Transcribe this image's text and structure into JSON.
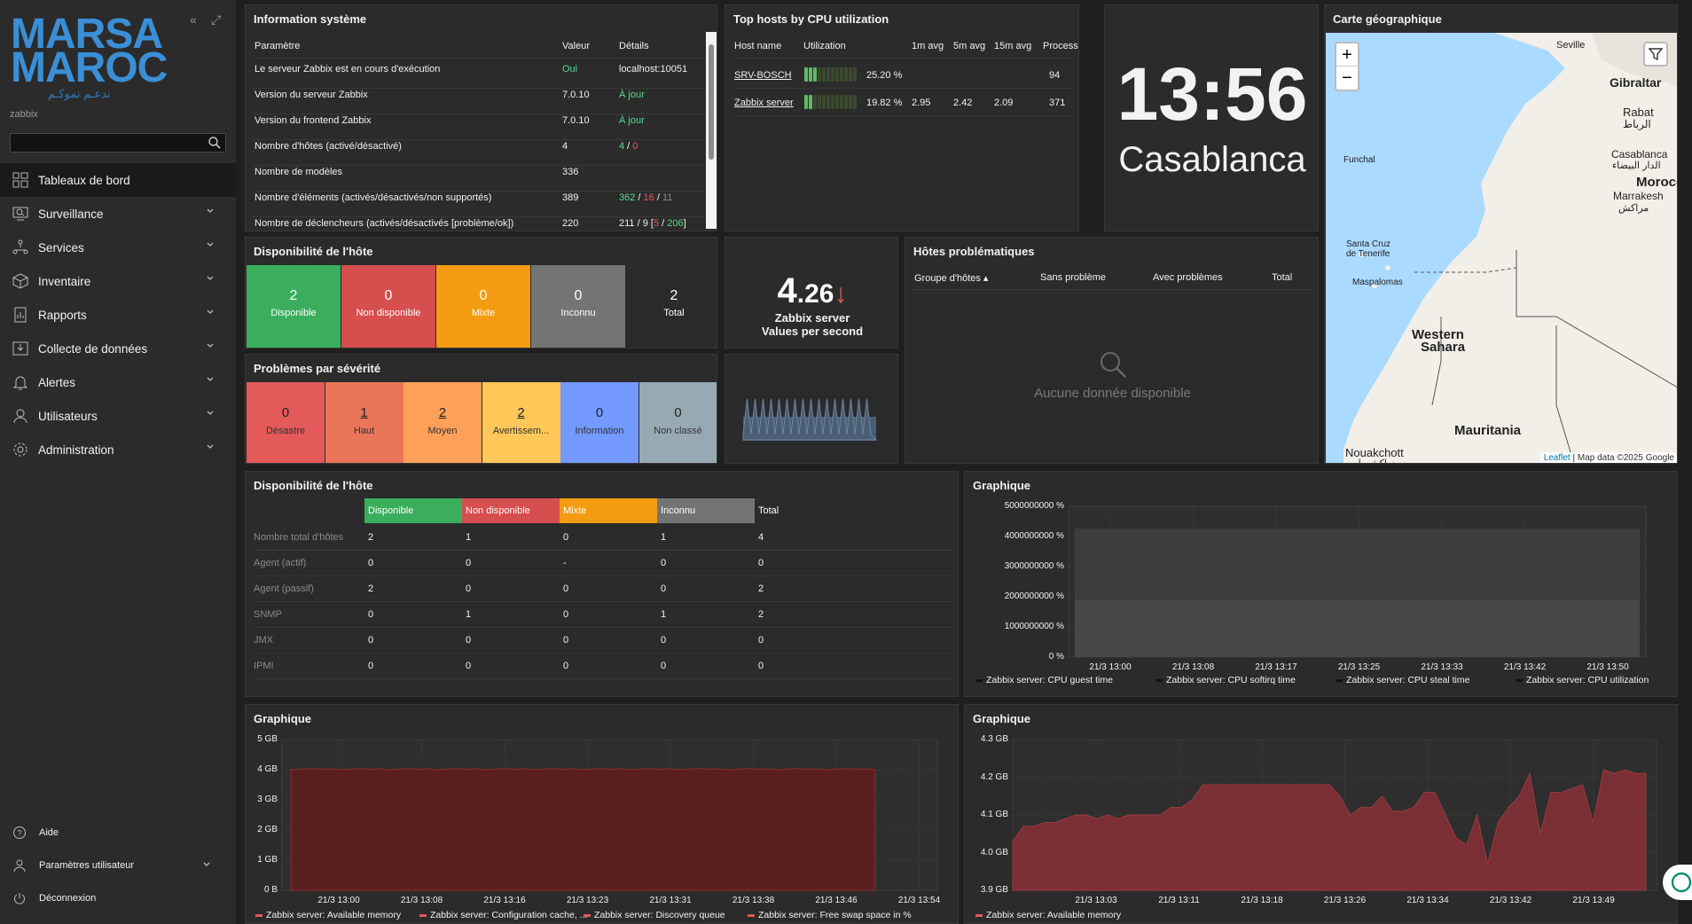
{
  "sidebar": {
    "brand": "zabbix",
    "logo": {
      "line1": "MARSA",
      "line2": "MAROC",
      "tagline": "ندعـم نموكـم"
    },
    "menu": [
      {
        "label": "Tableaux de bord",
        "icon": "dashboard-icon"
      },
      {
        "label": "Surveillance",
        "icon": "monitoring-icon"
      },
      {
        "label": "Services",
        "icon": "services-icon"
      },
      {
        "label": "Inventaire",
        "icon": "inventory-icon"
      },
      {
        "label": "Rapports",
        "icon": "reports-icon"
      },
      {
        "label": "Collecte de données",
        "icon": "data-collection-icon"
      },
      {
        "label": "Alertes",
        "icon": "bell-icon"
      },
      {
        "label": "Utilisateurs",
        "icon": "users-icon"
      },
      {
        "label": "Administration",
        "icon": "gear-icon"
      }
    ],
    "bottom": [
      {
        "label": "Aide",
        "icon": "help-icon"
      },
      {
        "label": "Paramètres utilisateur",
        "icon": "user-icon"
      },
      {
        "label": "Déconnexion",
        "icon": "power-icon"
      }
    ]
  },
  "sysinfo": {
    "title": "Information système",
    "headers": [
      "Paramètre",
      "Valeur",
      "Détails"
    ],
    "rows": [
      {
        "p": "Le serveur Zabbix est en cours d'exécution",
        "v": "Oui",
        "d": "localhost:10051"
      },
      {
        "p": "Version du serveur Zabbix",
        "v": "7.0.10",
        "d": "À jour"
      },
      {
        "p": "Version du frontend Zabbix",
        "v": "7.0.10",
        "d": "À jour"
      },
      {
        "p": "Nombre d'hôtes (activé/désactivé)",
        "v": "4",
        "d1": "4",
        "d2": "0"
      },
      {
        "p": "Nombre de modèles",
        "v": "336",
        "d": ""
      },
      {
        "p": "Nombre d'éléments (activés/désactivés/non supportés)",
        "v": "389",
        "d1": "362",
        "d2": "16",
        "d3": "11"
      },
      {
        "p": "Nombre de déclencheurs (activés/désactivés [problème/ok])",
        "v": "220",
        "d1": "211 / 9 [",
        "d2": "5",
        "d3": "206",
        "d4": "]"
      }
    ]
  },
  "tophosts": {
    "title": "Top hosts by CPU utilization",
    "headers": [
      "Host name",
      "Utilization",
      "1m avg",
      "5m avg",
      "15m avg",
      "Processes"
    ],
    "rows": [
      {
        "host": "SRV-BOSCH",
        "util": "25.20 %",
        "util_value": 25.2,
        "m1": "",
        "m5": "",
        "m15": "",
        "proc": "94"
      },
      {
        "host": "Zabbix server",
        "util": "19.82 %",
        "util_value": 19.82,
        "m1": "2.95",
        "m5": "2.42",
        "m15": "2.09",
        "proc": "371"
      }
    ]
  },
  "clock": {
    "time": "13:56",
    "city": "Casablanca"
  },
  "map": {
    "title": "Carte géographique",
    "zoom_in": "+",
    "zoom_out": "−",
    "labels": [
      "Seville",
      "Gibraltar",
      "Rabat",
      "الرباط",
      "Funchal",
      "Casablanca",
      "الدار البيضاء",
      "Morocco",
      "Marrakesh",
      "مراكش",
      "Santa Cruz",
      "de Tenerife",
      "Maspalomas",
      "Western",
      "Sahara",
      "Mauritania",
      "Nouakchott",
      "نواكشوط"
    ],
    "attribution_link": "Leaflet",
    "attribution": "| Map data ©2025 Google"
  },
  "hostavail": {
    "title": "Disponibilité de l'hôte",
    "tiles": [
      {
        "n": "2",
        "l": "Disponible",
        "color": "#3aae5c"
      },
      {
        "n": "0",
        "l": "Non disponible",
        "color": "#d64e4e"
      },
      {
        "n": "0",
        "l": "Mixte",
        "color": "#f39c12"
      },
      {
        "n": "0",
        "l": "Inconnu",
        "color": "#747474"
      }
    ],
    "total": {
      "n": "2",
      "l": "Total"
    }
  },
  "vps": {
    "value_int": "4",
    "value_dec": ".26",
    "l1": "Zabbix server",
    "l2": "Values per second"
  },
  "problems": {
    "title": "Hôtes problématiques",
    "headers": [
      "Groupe d'hôtes ▴",
      "Sans problème",
      "Avec problèmes",
      "Total"
    ],
    "empty": "Aucune donnée disponible"
  },
  "severity": {
    "title": "Problèmes par sévérité",
    "tiles": [
      {
        "n": "0",
        "l": "Désastre",
        "color": "#e45959"
      },
      {
        "n": "1",
        "l": "Haut",
        "color": "#e97659"
      },
      {
        "n": "2",
        "l": "Moyen",
        "color": "#ffa059"
      },
      {
        "n": "2",
        "l": "Avertissem...",
        "color": "#ffc859"
      },
      {
        "n": "0",
        "l": "Information",
        "color": "#7499ff"
      },
      {
        "n": "0",
        "l": "Non classé",
        "color": "#97aab3"
      }
    ]
  },
  "hostavail2": {
    "title": "Disponibilité de l'hôte",
    "headers": [
      "Disponible",
      "Non disponible",
      "Mixte",
      "Inconnu",
      "Total"
    ],
    "rows": [
      {
        "label": "Nombre total d'hôtes",
        "vals": [
          "2",
          "1",
          "0",
          "1",
          "4"
        ]
      },
      {
        "label": "Agent (actif)",
        "vals": [
          "0",
          "0",
          "-",
          "0",
          "0"
        ]
      },
      {
        "label": "Agent (passif)",
        "vals": [
          "2",
          "0",
          "0",
          "0",
          "2"
        ]
      },
      {
        "label": "SNMP",
        "vals": [
          "0",
          "1",
          "0",
          "1",
          "2"
        ]
      },
      {
        "label": "JMX",
        "vals": [
          "0",
          "0",
          "0",
          "0",
          "0"
        ]
      },
      {
        "label": "IPMI",
        "vals": [
          "0",
          "0",
          "0",
          "0",
          "0"
        ]
      }
    ]
  },
  "graph1": {
    "title": "Graphique",
    "yticks": [
      "5000000000 %",
      "4000000000 %",
      "3000000000 %",
      "2000000000 %",
      "1000000000 %",
      "0 %"
    ],
    "xticks": [
      "21/3 13:00",
      "21/3 13:08",
      "21/3 13:17",
      "21/3 13:25",
      "21/3 13:33",
      "21/3 13:42",
      "21/3 13:50"
    ],
    "legend": [
      "Zabbix server: CPU guest time",
      "Zabbix server: CPU softirq time",
      "Zabbix server: CPU steal time",
      "Zabbix server: CPU utilization"
    ]
  },
  "graph2": {
    "title": "Graphique",
    "yticks": [
      "5 GB",
      "4 GB",
      "3 GB",
      "2 GB",
      "1 GB",
      "0 B"
    ],
    "xticks": [
      "21/3 13:00",
      "21/3 13:08",
      "21/3 13:16",
      "21/3 13:23",
      "21/3 13:31",
      "21/3 13:38",
      "21/3 13:46",
      "21/3 13:54"
    ],
    "legend": [
      "Zabbix server: Available memory",
      "Zabbix server: Configuration cache, ...",
      "Zabbix server: Discovery queue",
      "Zabbix server: Free swap space in %"
    ]
  },
  "graph3": {
    "title": "Graphique",
    "yticks": [
      "4.3 GB",
      "4.2 GB",
      "4.1 GB",
      "4.0 GB",
      "3.9 GB"
    ],
    "xticks": [
      "21/3 13:03",
      "21/3 13:11",
      "21/3 13:18",
      "21/3 13:26",
      "21/3 13:34",
      "21/3 13:42",
      "21/3 13:49"
    ],
    "legend": [
      "Zabbix server: Available memory"
    ],
    "series_gb": [
      4.03,
      4.07,
      4.07,
      4.08,
      4.08,
      4.09,
      4.1,
      4.1,
      4.09,
      4.1,
      4.09,
      4.1,
      4.1,
      4.1,
      4.1,
      4.12,
      4.12,
      4.14,
      4.18,
      4.18,
      4.18,
      4.18,
      4.18,
      4.18,
      4.18,
      4.18,
      4.18,
      4.18,
      4.18,
      4.18,
      4.18,
      4.15,
      4.1,
      4.12,
      4.12,
      4.15,
      4.11,
      4.11,
      4.12,
      4.16,
      4.16,
      4.1,
      4.04,
      4.02,
      4.1,
      3.97,
      4.08,
      4.12,
      4.15,
      4.21,
      4.05,
      4.16,
      4.16,
      4.17,
      4.18,
      4.08,
      4.22,
      4.21,
      4.22,
      4.21,
      4.21
    ]
  }
}
